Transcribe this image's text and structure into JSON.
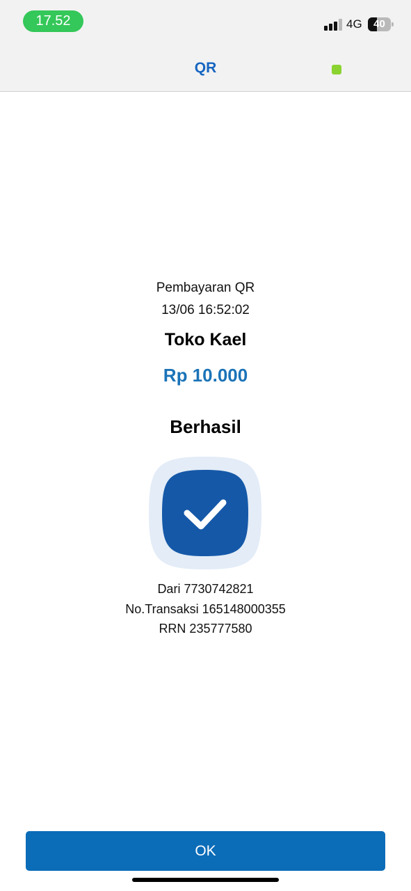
{
  "status_bar": {
    "time": "17.52",
    "network": "4G",
    "battery_level": "40",
    "signal_icon": "cellular-signal-icon",
    "battery_icon": "battery-icon"
  },
  "nav": {
    "title": "QR",
    "indicator_icon": "status-indicator-icon",
    "indicator_color": "#8bd330"
  },
  "transaction": {
    "type": "Pembayaran QR",
    "datetime": "13/06 16:52:02",
    "merchant": "Toko Kael",
    "amount": "Rp 10.000",
    "status": "Berhasil",
    "status_icon": "check-icon",
    "from": "Dari 7730742821",
    "transaction_number": "No.Transaksi 165148000355",
    "rrn": "RRN 235777580"
  },
  "actions": {
    "ok_label": "OK"
  },
  "colors": {
    "primary": "#0b6cb8",
    "title_blue": "#1565c0",
    "amount_blue": "#1a73b8",
    "success_badge": "#1558a8",
    "success_badge_halo": "#e3ecf7",
    "time_pill": "#34c759"
  }
}
